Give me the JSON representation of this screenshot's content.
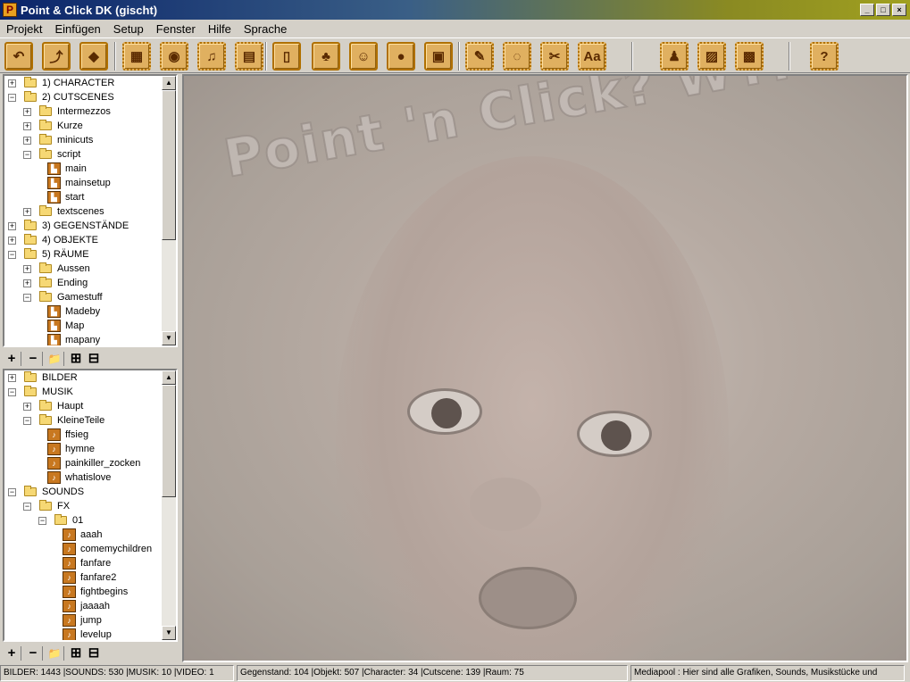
{
  "window": {
    "app_icon": "P",
    "title": "Point & Click DK (gischt)",
    "minimize": "_",
    "maximize": "□",
    "close": "×"
  },
  "menu": [
    "Projekt",
    "Einfügen",
    "Setup",
    "Fenster",
    "Hilfe",
    "Sprache"
  ],
  "toolbar_icons": [
    "character-icon",
    "cutscene-icon",
    "item-icon",
    "image-icon",
    "sound-icon",
    "music-icon",
    "video-icon",
    "room-icon",
    "object-icon",
    "characters-icon",
    "items-icon",
    "cutscenes-icon",
    "editor-icon",
    "mouse-icon",
    "tools-icon",
    "font-icon",
    "wizard-icon",
    "export-icon",
    "settings-icon",
    "help-icon"
  ],
  "toolbar_glyphs": [
    "↶",
    "⤴",
    "◆",
    "▦",
    "◉",
    "♫",
    "▤",
    "▯",
    "♣",
    "☺",
    "●",
    "▣",
    "✎",
    "◌",
    "✂",
    "Aa",
    "♟",
    "▨",
    "▩",
    "?"
  ],
  "game_tree": [
    {
      "d": 0,
      "e": "+",
      "t": "f",
      "label": "1) CHARACTER"
    },
    {
      "d": 0,
      "e": "−",
      "t": "f",
      "label": "2) CUTSCENES"
    },
    {
      "d": 1,
      "e": "+",
      "t": "f",
      "label": "Intermezzos"
    },
    {
      "d": 1,
      "e": "+",
      "t": "f",
      "label": "Kurze"
    },
    {
      "d": 1,
      "e": "+",
      "t": "f",
      "label": "minicuts"
    },
    {
      "d": 1,
      "e": "−",
      "t": "f",
      "label": "script"
    },
    {
      "d": 2,
      "e": "",
      "t": "i",
      "label": "main"
    },
    {
      "d": 2,
      "e": "",
      "t": "i",
      "label": "mainsetup"
    },
    {
      "d": 2,
      "e": "",
      "t": "i",
      "label": "start"
    },
    {
      "d": 1,
      "e": "+",
      "t": "f",
      "label": "textscenes"
    },
    {
      "d": 0,
      "e": "+",
      "t": "f",
      "label": "3) GEGENSTÄNDE"
    },
    {
      "d": 0,
      "e": "+",
      "t": "f",
      "label": "4) OBJEKTE"
    },
    {
      "d": 0,
      "e": "−",
      "t": "f",
      "label": "5) RÄUME"
    },
    {
      "d": 1,
      "e": "+",
      "t": "f",
      "label": "Aussen"
    },
    {
      "d": 1,
      "e": "+",
      "t": "f",
      "label": "Ending"
    },
    {
      "d": 1,
      "e": "−",
      "t": "f",
      "label": "Gamestuff"
    },
    {
      "d": 2,
      "e": "",
      "t": "i",
      "label": "Madeby"
    },
    {
      "d": 2,
      "e": "",
      "t": "i",
      "label": "Map"
    },
    {
      "d": 2,
      "e": "",
      "t": "i",
      "label": "mapany"
    }
  ],
  "media_tree": [
    {
      "d": 0,
      "e": "+",
      "t": "f",
      "label": "BILDER"
    },
    {
      "d": 0,
      "e": "−",
      "t": "f",
      "label": "MUSIK"
    },
    {
      "d": 1,
      "e": "+",
      "t": "f",
      "label": "Haupt"
    },
    {
      "d": 1,
      "e": "−",
      "t": "f",
      "label": "KleineTeile"
    },
    {
      "d": 2,
      "e": "",
      "t": "i",
      "label": "ffsieg"
    },
    {
      "d": 2,
      "e": "",
      "t": "i",
      "label": "hymne"
    },
    {
      "d": 2,
      "e": "",
      "t": "i",
      "label": "painkiller_zocken"
    },
    {
      "d": 2,
      "e": "",
      "t": "i",
      "label": "whatislove"
    },
    {
      "d": 0,
      "e": "−",
      "t": "f",
      "label": "SOUNDS"
    },
    {
      "d": 1,
      "e": "−",
      "t": "f",
      "label": "FX"
    },
    {
      "d": 2,
      "e": "−",
      "t": "f",
      "label": "01"
    },
    {
      "d": 3,
      "e": "",
      "t": "i",
      "label": "aaah"
    },
    {
      "d": 3,
      "e": "",
      "t": "i",
      "label": "comemychildren"
    },
    {
      "d": 3,
      "e": "",
      "t": "i",
      "label": "fanfare"
    },
    {
      "d": 3,
      "e": "",
      "t": "i",
      "label": "fanfare2"
    },
    {
      "d": 3,
      "e": "",
      "t": "i",
      "label": "fightbegins"
    },
    {
      "d": 3,
      "e": "",
      "t": "i",
      "label": "jaaaah"
    },
    {
      "d": 3,
      "e": "",
      "t": "i",
      "label": "jump"
    },
    {
      "d": 3,
      "e": "",
      "t": "i",
      "label": "levelup"
    }
  ],
  "mini_toolbar": {
    "add": "+",
    "remove": "−",
    "folder": "📁",
    "grid": "⊞",
    "split": "⊟"
  },
  "canvas": {
    "watermark": "Point 'n Click? WTF?"
  },
  "status": {
    "media_counts": "BILDER: 1443 |SOUNDS: 530 |MUSIK: 10 |VIDEO: 1",
    "game_counts": "Gegenstand: 104 |Objekt: 507 |Character: 34 |Cutscene: 139 |Raum: 75",
    "hint": "Mediapool : Hier sind alle Grafiken, Sounds, Musikstücke und"
  }
}
